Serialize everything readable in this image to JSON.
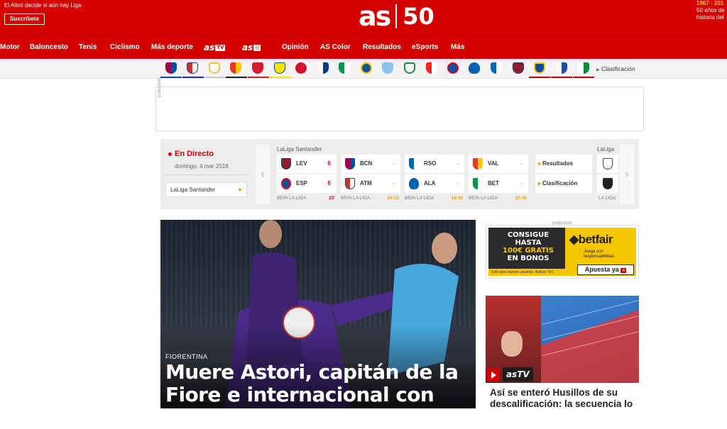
{
  "header": {
    "promo_text": "El Atleti decide si aún hay Liga",
    "subscribe_label": "Suscríbete",
    "logo_main": "as",
    "logo_anniversary": "50",
    "anniversary_years": "1967 - 201",
    "anniversary_text": "50 años de historia del"
  },
  "nav": {
    "items": [
      "Motor",
      "Baloncesto",
      "Tenis",
      "Ciclismo",
      "Más deporte"
    ],
    "astv": "as",
    "astv_badge": "TV",
    "asfoto": "as",
    "asfoto_badge": "◎",
    "items2": [
      "Opinión",
      "AS Color",
      "Resultados",
      "eSports",
      "Más"
    ]
  },
  "teams_bar": {
    "link": "Clasificación"
  },
  "live": {
    "title": "En Directo",
    "date": "domingo, 4 mar 2018",
    "competition": "LaLiga Santander",
    "league_label": "LaLiga Santander",
    "league_label_right": "LaLiga",
    "matches": [
      {
        "home": "LEV",
        "home_score": "0",
        "away": "ESP",
        "away_score": "0",
        "tv": "BEIN LA LIGA",
        "time": "23'"
      },
      {
        "home": "BCN",
        "home_score": "-",
        "away": "ATM",
        "away_score": "-",
        "tv": "BEIN LA LIGA",
        "time": "16:15"
      },
      {
        "home": "RSO",
        "home_score": "-",
        "away": "ALA",
        "away_score": "-",
        "tv": "BEIN LA LIGA",
        "time": "18:30"
      },
      {
        "home": "VAL",
        "home_score": "-",
        "away": "BET",
        "away_score": "-",
        "tv": "BEIN LA LIGA",
        "time": "20:45"
      }
    ],
    "links": [
      "Resultados",
      "Clasificación"
    ],
    "ghost_tv": "LA LIGA"
  },
  "hero": {
    "kicker": "FIORENTINA",
    "headline": "Muere Astori, capitán de la Fiore e internacional con Italia"
  },
  "sidebar": {
    "pub_label": "publicidad",
    "ad": {
      "line1": "CONSIGUE",
      "line2": "HASTA",
      "line3": "100€ GRATIS",
      "line4": "EN BONOS",
      "brand": "betfair",
      "sub": "Juega con responsabilidad.",
      "fine": "Solo para nuevos usuarios. Aplican TyC.",
      "cta": "Apuesta ya"
    },
    "video_brand": "asTV",
    "headline": "Así se enteró Husillos de su descalificación: la secuencia lo"
  },
  "ad_label": "publicidad",
  "colors": {
    "brand_red": "#d40000",
    "accent_yellow": "#f0a000"
  }
}
